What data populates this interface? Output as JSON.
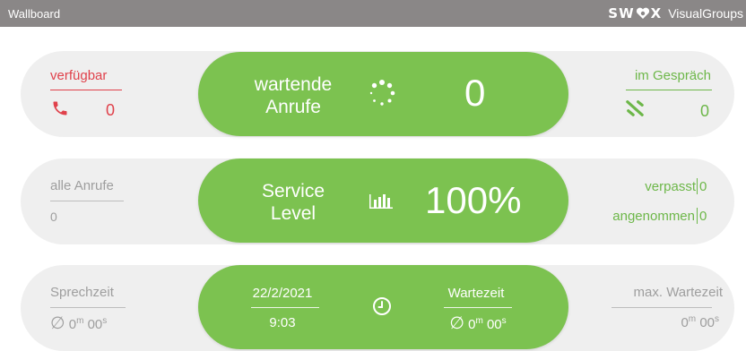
{
  "header": {
    "title": "Wallboard",
    "brand_logo": "SWYX",
    "brand_name": "VisualGroups"
  },
  "row1": {
    "left": {
      "label": "verfügbar",
      "value": "0",
      "icon": "phone-icon",
      "color": "#e0414b"
    },
    "center": {
      "label_line1": "wartende",
      "label_line2": "Anrufe",
      "icon": "loading-spinner-icon",
      "value": "0"
    },
    "right": {
      "label": "im Gespräch",
      "value": "0",
      "icon": "talking-phone-icon",
      "color": "#6db749"
    }
  },
  "row2": {
    "left": {
      "label": "alle Anrufe",
      "value": "0"
    },
    "center": {
      "label_line1": "Service",
      "label_line2": "Level",
      "icon": "bar-chart-icon",
      "value": "100%"
    },
    "right": {
      "missed_label": "verpasst",
      "missed_value": "0",
      "accepted_label": "angenommen",
      "accepted_value": "0"
    }
  },
  "row3": {
    "left": {
      "label": "Sprechzeit",
      "avg_symbol": "∅",
      "minutes": "0",
      "minutes_unit": "m",
      "seconds": "00",
      "seconds_unit": "s"
    },
    "center": {
      "date": "22/2/2021",
      "time": "9:03",
      "icon": "clock-icon",
      "wait_label": "Wartezeit",
      "avg_symbol": "∅",
      "minutes": "0",
      "minutes_unit": "m",
      "seconds": "00",
      "seconds_unit": "s"
    },
    "right": {
      "label": "max. Wartezeit",
      "minutes": "0",
      "minutes_unit": "m",
      "seconds": "00",
      "seconds_unit": "s"
    }
  },
  "colors": {
    "accent_green": "#7cc250",
    "band_grey": "#efefef",
    "header_grey": "#8a8787"
  }
}
